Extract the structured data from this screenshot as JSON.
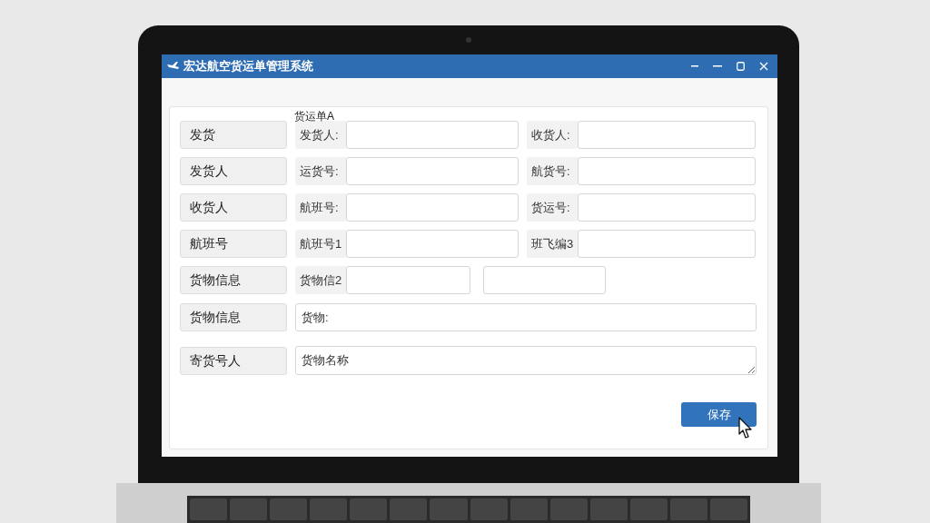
{
  "window": {
    "title": "宏达航空货运单管理系统"
  },
  "form": {
    "caption": "货运单A",
    "rows": [
      {
        "kind": "pair",
        "label": "发货",
        "fields": [
          {
            "label": "发货人:"
          },
          {
            "label": "收货人:"
          }
        ]
      },
      {
        "kind": "pair",
        "label": "发货人",
        "fields": [
          {
            "label": "运货号:"
          },
          {
            "label": "航货号:"
          }
        ]
      },
      {
        "kind": "pair",
        "label": "收货人",
        "fields": [
          {
            "label": "航班号:"
          },
          {
            "label": "货运号:"
          }
        ]
      },
      {
        "kind": "pair",
        "label": "航班号",
        "fields": [
          {
            "label": "航班号1"
          },
          {
            "label": "班飞编3"
          }
        ]
      },
      {
        "kind": "split",
        "label": "货物信息",
        "fields": [
          {
            "label": "货物信2"
          }
        ]
      },
      {
        "kind": "wide",
        "label": "货物信息",
        "value": "货物:"
      },
      {
        "kind": "area",
        "label": "寄货号人",
        "value": "货物名称"
      }
    ],
    "buttons": [
      {
        "label": "保存"
      }
    ]
  }
}
